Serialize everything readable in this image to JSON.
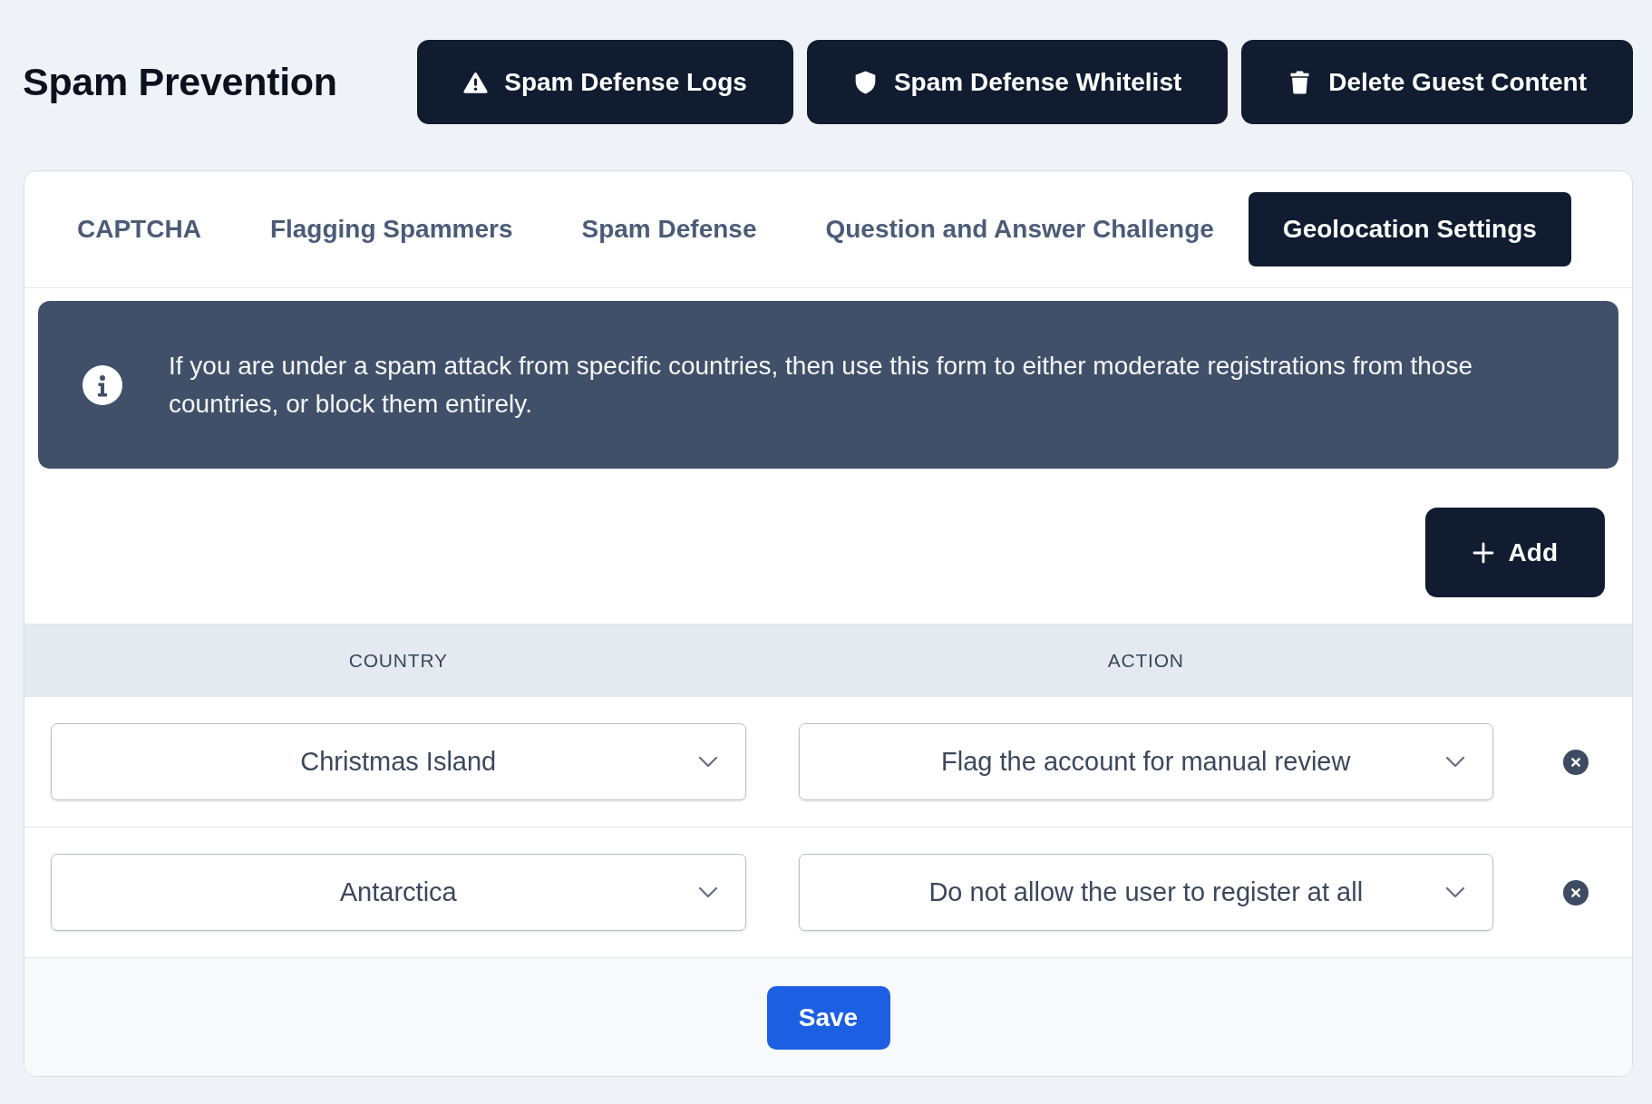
{
  "header": {
    "title": "Spam Prevention",
    "buttons": [
      {
        "label": "Spam Defense Logs"
      },
      {
        "label": "Spam Defense Whitelist"
      },
      {
        "label": "Delete Guest Content"
      }
    ]
  },
  "tabs": [
    {
      "label": "CAPTCHA",
      "selected": false
    },
    {
      "label": "Flagging Spammers",
      "selected": false
    },
    {
      "label": "Spam Defense",
      "selected": false
    },
    {
      "label": "Question and Answer Challenge",
      "selected": false
    },
    {
      "label": "Geolocation Settings",
      "selected": true
    }
  ],
  "info_banner": {
    "text": "If you are under a spam attack from specific countries, then use this form to either moderate registrations from those countries, or block them entirely."
  },
  "add_button": {
    "label": "Add"
  },
  "table": {
    "columns": [
      "COUNTRY",
      "ACTION"
    ],
    "rows": [
      {
        "country": "Christmas Island",
        "action": "Flag the account for manual review"
      },
      {
        "country": "Antarctica",
        "action": "Do not allow the user to register at all"
      }
    ]
  },
  "save_button": {
    "label": "Save"
  }
}
